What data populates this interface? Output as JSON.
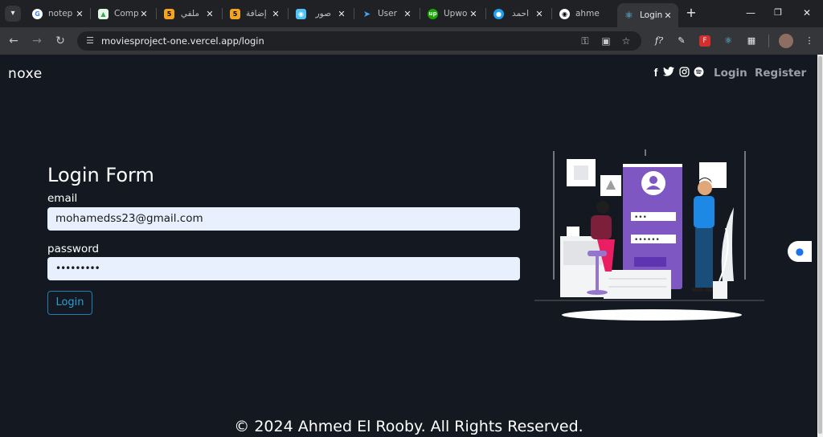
{
  "browser": {
    "tabs": [
      {
        "title": "notep",
        "icon": "google-icon",
        "color": "#ffffff"
      },
      {
        "title": "Comp",
        "icon": "compass-icon",
        "color": "#34a853"
      },
      {
        "title": "ملفي",
        "icon": "html5-icon",
        "color": "#f4a41e"
      },
      {
        "title": "إضافة",
        "icon": "html5-icon",
        "color": "#f4a41e"
      },
      {
        "title": "صور",
        "icon": "image-icon",
        "color": "#4fc3f7"
      },
      {
        "title": "User",
        "icon": "bird-icon",
        "color": "#42a5f5"
      },
      {
        "title": "Upwo",
        "icon": "upwork-icon",
        "color": "#14a800"
      },
      {
        "title": "احمد",
        "icon": "circle-icon",
        "color": "#1da1f2"
      },
      {
        "title": "ahme",
        "icon": "github-icon",
        "color": "#ffffff"
      },
      {
        "title": "Login",
        "icon": "react-icon",
        "color": "#61dafb",
        "active": true
      }
    ],
    "url": "moviesproject-one.vercel.app/login"
  },
  "nav": {
    "brand": "noxe",
    "social": [
      "facebook-icon",
      "twitter-icon",
      "instagram-icon",
      "spotify-icon"
    ],
    "login": "Login",
    "register": "Register"
  },
  "form": {
    "title": "Login Form",
    "email_label": "email",
    "email_value": "mohamedss23@gmail.com",
    "password_label": "password",
    "password_value": "•••••••••",
    "submit": "Login"
  },
  "illustration": {
    "password_dots": "•••",
    "password_dots_2": "••••••"
  },
  "footer": "© 2024 Ahmed El Rooby. All Rights Reserved.",
  "colors": {
    "page_bg": "#141821",
    "accent": "#2a9fd6",
    "field_bg": "#e8f0fe"
  }
}
